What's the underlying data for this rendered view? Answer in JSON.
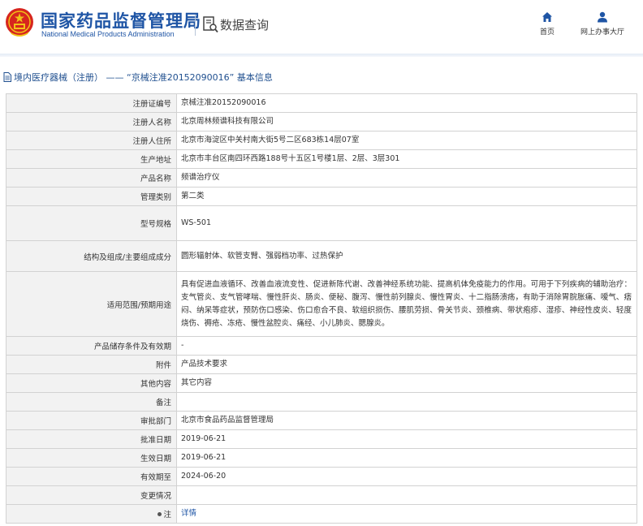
{
  "header": {
    "site_title_cn": "国家药品监督管理局",
    "site_title_en": "National Medical Products Administration",
    "query_label": "数据查询",
    "nav": {
      "home_label": "首页",
      "service_hall_label": "网上办事大厅"
    },
    "icons": {
      "emblem": "national-emblem-icon",
      "query": "document-search-icon",
      "home": "home-icon",
      "service_hall": "user-icon"
    }
  },
  "section": {
    "title": "境内医疗器械（注册） —— “京械注准20152090016” 基本信息",
    "icon": "document-icon"
  },
  "rows": [
    {
      "label": "注册证编号",
      "value": "京械注准20152090016"
    },
    {
      "label": "注册人名称",
      "value": "北京周林频谱科技有限公司"
    },
    {
      "label": "注册人住所",
      "value": "北京市海淀区中关村南大街5号二区683栋14层07室"
    },
    {
      "label": "生产地址",
      "value": "北京市丰台区南四环西路188号十五区1号楼1层、2层、3层301"
    },
    {
      "label": "产品名称",
      "value": "频谱治疗仪"
    },
    {
      "label": "管理类别",
      "value": "第二类"
    },
    {
      "label": "型号规格",
      "value": "WS-501"
    },
    {
      "label": "结构及组成/主要组成成分",
      "value": "圆形辐射体、软管支臂、强弱档功率、过热保护"
    },
    {
      "label": "适用范围/预期用途",
      "value": "具有促进血液循环、改善血液流变性、促进新陈代谢、改善神经系统功能、提高机体免疫能力的作用。可用于下列疾病的辅助治疗：支气管炎、支气管哮喘、慢性肝炎、肠炎、便秘、腹泻、慢性前列腺炎、慢性胃炎、十二指肠溃疡，有助于消除胃脘胀痛、嗳气、痞闷、纳呆等症状，预防伤口感染、伤口愈合不良、软组织损伤、腰肌劳损、骨关节炎、颈椎病、带状疱疹、湿疹、神经性皮炎、轻度烧伤、褥疮、冻疮、慢性盆腔炎、痛经、小儿肺炎、腮腺炎。"
    },
    {
      "label": "产品储存条件及有效期",
      "value": "-"
    },
    {
      "label": "附件",
      "value": "产品技术要求"
    },
    {
      "label": "其他内容",
      "value": "其它内容"
    },
    {
      "label": "备注",
      "value": ""
    },
    {
      "label": "审批部门",
      "value": "北京市食品药品监督管理局"
    },
    {
      "label": "批准日期",
      "value": "2019-06-21"
    },
    {
      "label": "生效日期",
      "value": "2019-06-21"
    },
    {
      "label": "有效期至",
      "value": "2024-06-20"
    },
    {
      "label": "变更情况",
      "value": ""
    },
    {
      "label": "注",
      "value": "详情"
    }
  ],
  "colors": {
    "brand_blue": "#1f55a5",
    "label_bg": "#f2f2f2",
    "border": "#d2d2d2",
    "emblem_red": "#d7261e",
    "emblem_gold": "#f2c318"
  }
}
